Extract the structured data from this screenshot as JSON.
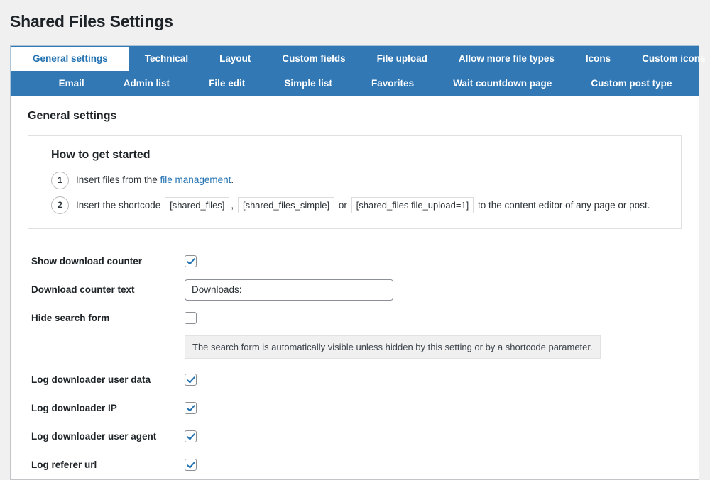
{
  "page": {
    "title": "Shared Files Settings"
  },
  "tabs": {
    "row1": [
      {
        "label": "General settings",
        "active": true
      },
      {
        "label": "Technical",
        "active": false
      },
      {
        "label": "Layout",
        "active": false
      },
      {
        "label": "Custom fields",
        "active": false
      },
      {
        "label": "File upload",
        "active": false
      },
      {
        "label": "Allow more file types",
        "active": false
      },
      {
        "label": "Icons",
        "active": false
      },
      {
        "label": "Custom icons",
        "active": false
      }
    ],
    "row2": [
      {
        "label": "Email",
        "active": false
      },
      {
        "label": "Admin list",
        "active": false
      },
      {
        "label": "File edit",
        "active": false
      },
      {
        "label": "Simple list",
        "active": false
      },
      {
        "label": "Favorites",
        "active": false
      },
      {
        "label": "Wait countdown page",
        "active": false
      },
      {
        "label": "Custom post type",
        "active": false
      }
    ]
  },
  "content": {
    "heading": "General settings",
    "started": {
      "title": "How to get started",
      "step1": {
        "number": "1",
        "text_before": "Insert files from the ",
        "link": "file management",
        "text_after": "."
      },
      "step2": {
        "number": "2",
        "text_before": "Insert the shortcode",
        "code1": "[shared_files]",
        "sep1": ",",
        "code2": "[shared_files_simple]",
        "sep2": "or",
        "code3": "[shared_files file_upload=1]",
        "text_after": "to the content editor of any page or post."
      }
    },
    "settings": [
      {
        "label": "Show download counter",
        "type": "checkbox",
        "checked": true
      },
      {
        "label": "Download counter text",
        "type": "text",
        "value": "Downloads:",
        "placeholder": ""
      },
      {
        "label": "Hide search form",
        "type": "checkbox",
        "checked": false,
        "hint": "The search form is automatically visible unless hidden by this setting or by a shortcode parameter."
      },
      {
        "label": "Log downloader user data",
        "type": "checkbox",
        "checked": true
      },
      {
        "label": "Log downloader IP",
        "type": "checkbox",
        "checked": true
      },
      {
        "label": "Log downloader user agent",
        "type": "checkbox",
        "checked": true
      },
      {
        "label": "Log referer url",
        "type": "checkbox",
        "checked": true
      }
    ]
  },
  "colors": {
    "tab_blue": "#3178b5",
    "link_blue": "#2271b1",
    "page_bg": "#f0f0f1"
  }
}
